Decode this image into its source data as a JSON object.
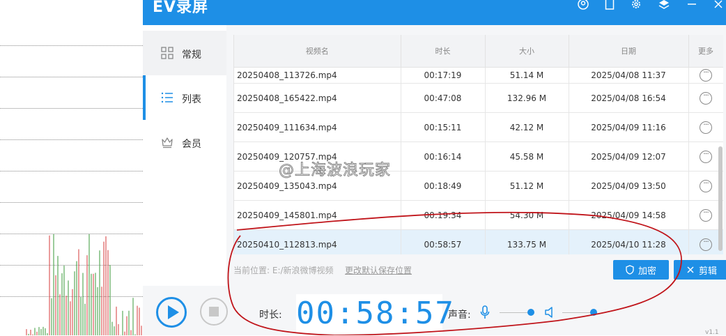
{
  "window": {
    "title": "EV录屏"
  },
  "sidebar": {
    "items": [
      {
        "label": "常规",
        "icon": "grid-icon"
      },
      {
        "label": "列表",
        "icon": "list-icon"
      },
      {
        "label": "会员",
        "icon": "crown-icon"
      }
    ],
    "active": "列表"
  },
  "table": {
    "headers": [
      "视频名",
      "时长",
      "大小",
      "日期",
      "更多"
    ],
    "rows": [
      {
        "name": "20250408_113726.mp4",
        "duration": "00:17:19",
        "size": "51.14 M",
        "date": "2025/04/08 11:37"
      },
      {
        "name": "20250408_165422.mp4",
        "duration": "00:47:08",
        "size": "132.96 M",
        "date": "2025/04/08 16:54"
      },
      {
        "name": "20250409_111634.mp4",
        "duration": "00:15:11",
        "size": "42.12 M",
        "date": "2025/04/09 11:16"
      },
      {
        "name": "20250409_120757.mp4",
        "duration": "00:16:14",
        "size": "45.58 M",
        "date": "2025/04/09 12:07"
      },
      {
        "name": "20250409_135043.mp4",
        "duration": "00:18:49",
        "size": "51.12 M",
        "date": "2025/04/09 13:50"
      },
      {
        "name": "20250409_145801.mp4",
        "duration": "00:19:34",
        "size": "54.30 M",
        "date": "2025/04/09 14:58"
      },
      {
        "name": "20250410_112813.mp4",
        "duration": "00:58:57",
        "size": "133.75 M",
        "date": "2025/04/10 11:28"
      }
    ],
    "selected_index": 6
  },
  "path": {
    "label": "当前位置: E:/新浪微博视频",
    "change_link": "更改默认保存位置"
  },
  "buttons": {
    "encrypt": "加密",
    "edit": "剪辑"
  },
  "player": {
    "duration_label": "时长:",
    "timer": "00:58:57",
    "volume_label": "声音:",
    "mic_level": 0.9,
    "speaker_level": 0.9
  },
  "watermark": "@上海波浪玩家",
  "version": "v1.1",
  "colors": {
    "accent": "#1e8fe6",
    "annotation": "#c0141a"
  }
}
